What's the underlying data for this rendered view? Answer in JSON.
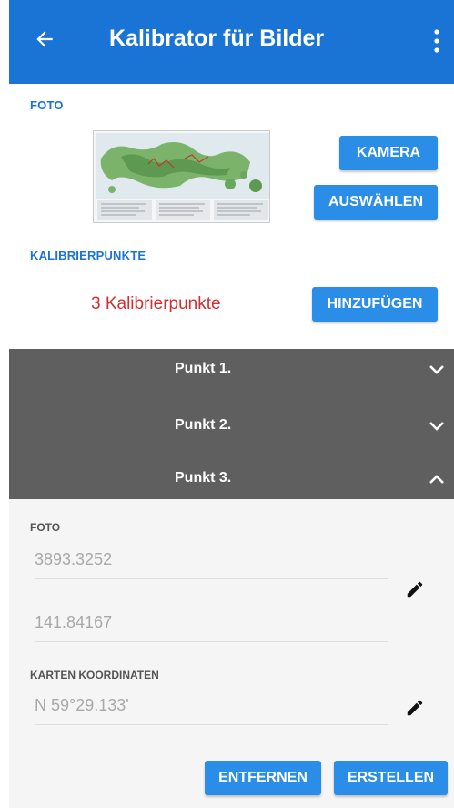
{
  "appbar": {
    "title": "Kalibrator für Bilder",
    "back_icon": "arrow-left-icon",
    "menu_icon": "more-vert-icon",
    "color": "#1a74d6"
  },
  "foto_section": {
    "label": "FOTO",
    "camera_button": "KAMERA",
    "select_button": "AUSWÄHLEN"
  },
  "calibration_section": {
    "label": "KALIBRIERPUNKTE",
    "count_text": "3 Kalibrierpunkte",
    "add_button": "HINZUFÜGEN"
  },
  "points": [
    {
      "label": "Punkt 1.",
      "expanded": false
    },
    {
      "label": "Punkt 2.",
      "expanded": false
    },
    {
      "label": "Punkt 3.",
      "expanded": true
    }
  ],
  "point_detail": {
    "photo_label": "FOTO",
    "photo_x": "3893.3252",
    "photo_y": "141.84167",
    "map_label": "KARTEN KOORDINATEN",
    "map_coord": "N 59°29.133'",
    "remove_button": "ENTFERNEN",
    "create_button": "ERSTELLEN"
  },
  "colors": {
    "accent": "#1a74d6",
    "button": "#2a8ee8",
    "warning_text": "#d32f2f",
    "points_bg": "#5f5f5f"
  }
}
